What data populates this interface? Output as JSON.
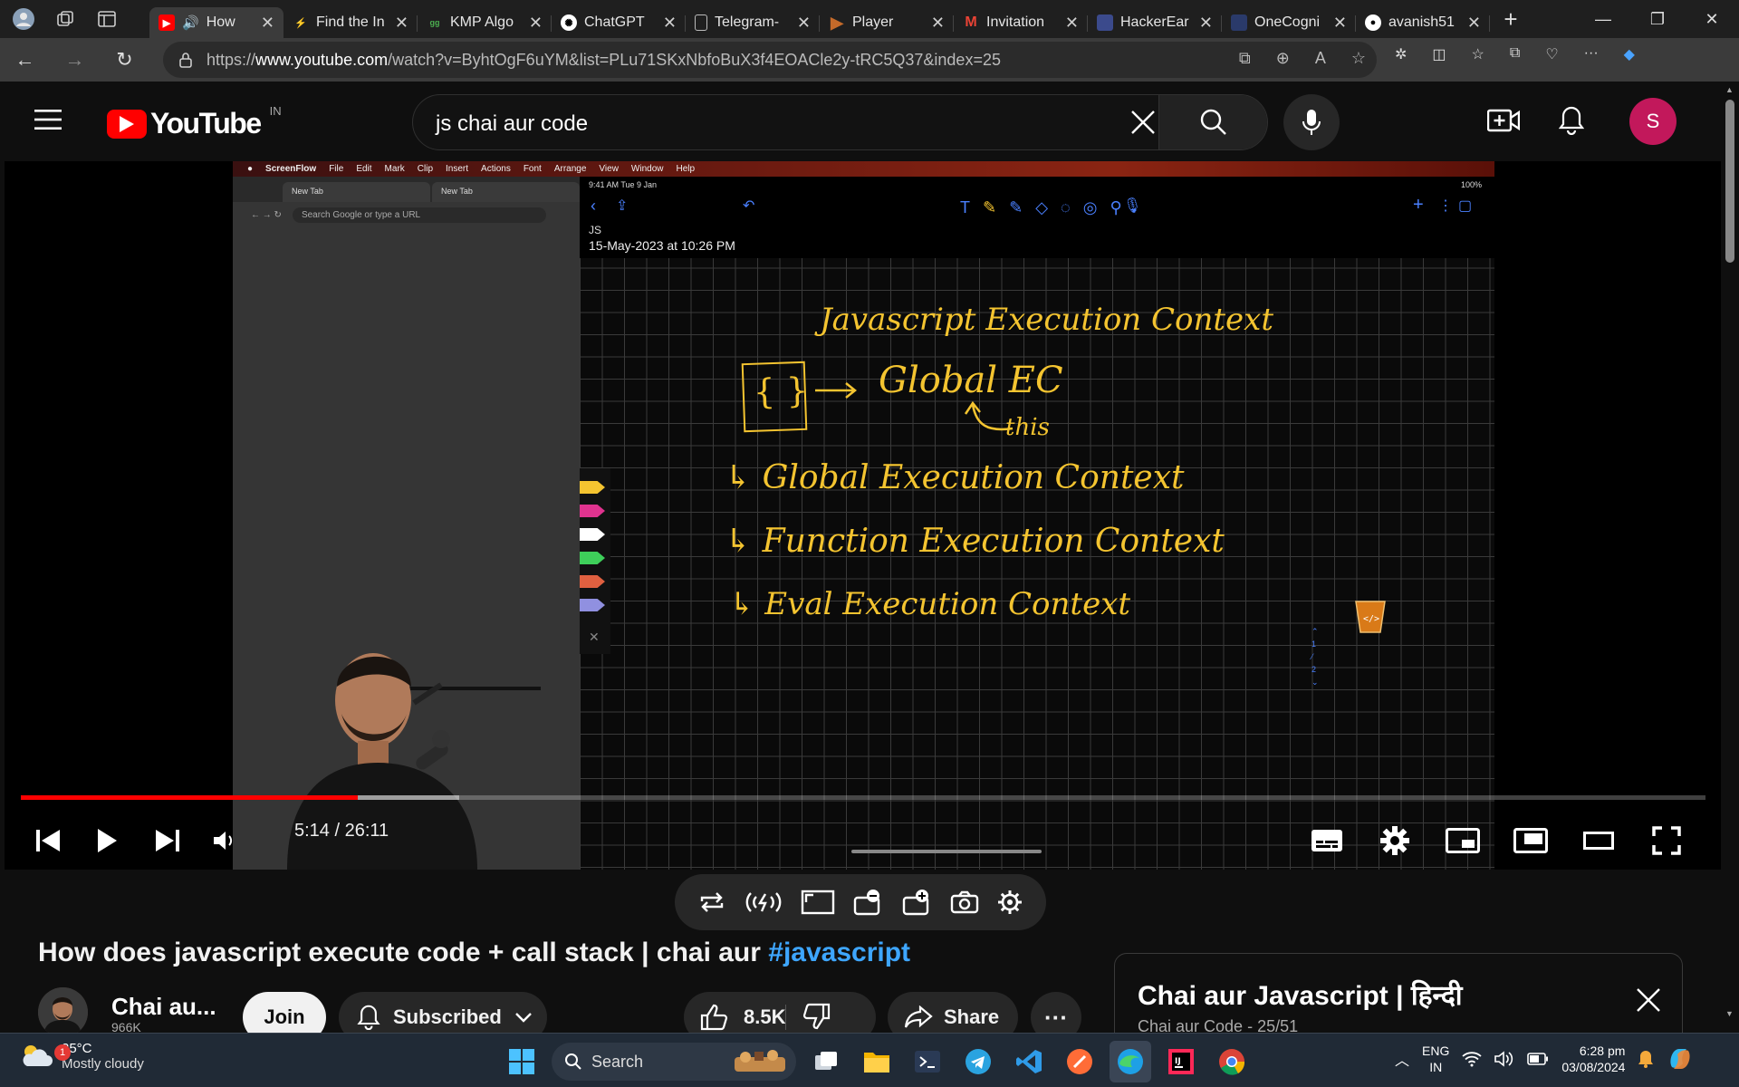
{
  "browser": {
    "tabs": [
      {
        "title": "How",
        "favicon_color": "#ff0000",
        "active": true
      },
      {
        "title": "Find the In",
        "favicon_color": "#f4a93b"
      },
      {
        "title": "KMP Algo",
        "favicon_color": "#2e7d32"
      },
      {
        "title": "ChatGPT",
        "favicon_color": "#ffffff"
      },
      {
        "title": "Telegram-",
        "favicon_color": "#bbbbbb"
      },
      {
        "title": "Player",
        "favicon_color": "#c46a2a"
      },
      {
        "title": "Invitation",
        "favicon_color": "#ea4335"
      },
      {
        "title": "HackerEar",
        "favicon_color": "#3b4a8c"
      },
      {
        "title": "OneCogni",
        "favicon_color": "#2a3a6a"
      },
      {
        "title": "avanish51",
        "favicon_color": "#ffffff"
      }
    ],
    "url_prefix": "https://",
    "url_host": "www.youtube.com",
    "url_path": "/watch?v=ByhtOgF6uYM&list=PLu71SKxNbfoBuX3f4EOACle2y-tRC5Q37&index=25"
  },
  "youtube": {
    "logo_text": "YouTube",
    "country_code": "IN",
    "search_query": "js chai aur code",
    "avatar_letter": "S"
  },
  "video_frame": {
    "mac_menu": [
      "ScreenFlow",
      "File",
      "Edit",
      "Mark",
      "Clip",
      "Insert",
      "Actions",
      "Font",
      "Arrange",
      "View",
      "Window",
      "Help"
    ],
    "chrome_tabs": [
      "New Tab",
      "New Tab"
    ],
    "chrome_omnibox": "Search Google or type a URL",
    "ipad_time": "9:41 AM  Tue 9 Jan",
    "ipad_battery": "100%",
    "note_heading": "JS",
    "note_date": "15-May-2023 at 10:26 PM",
    "handwriting": {
      "title": "Javascript Execution Context",
      "braces": "{ }",
      "global": "Global  EC",
      "this": "this",
      "item1": "↳ Global Execution Context",
      "item2": "↳ Function Execution Context",
      "item3": "↳ Eval Execution Context"
    }
  },
  "player": {
    "current_time": "5:14",
    "duration": "26:11",
    "time_display": "5:14 / 26:11",
    "progress_fraction": 0.2,
    "buffered_fraction": 0.26
  },
  "video": {
    "title": "How does javascript execute code + call stack | chai aur ",
    "hashtag": "#javascript",
    "channel_name": "Chai au...",
    "subscribers": "966K",
    "join_label": "Join",
    "subscribed_label": "Subscribed",
    "likes": "8.5K",
    "share_label": "Share"
  },
  "playlist": {
    "title": "Chai aur Javascript | हिन्दी",
    "subtitle": "Chai aur Code - 25/51"
  },
  "taskbar": {
    "weather_badge": "1",
    "temperature": "25°C",
    "weather_desc": "Mostly cloudy",
    "search_label": "Search",
    "lang_line1": "ENG",
    "lang_line2": "IN",
    "time": "6:28 pm",
    "date": "03/08/2024"
  },
  "colors": {
    "youtube_red": "#ff0000",
    "link_blue": "#3ea6ff",
    "handwriting_yellow": "#f4c430",
    "avatar_pink": "#c2185b"
  }
}
